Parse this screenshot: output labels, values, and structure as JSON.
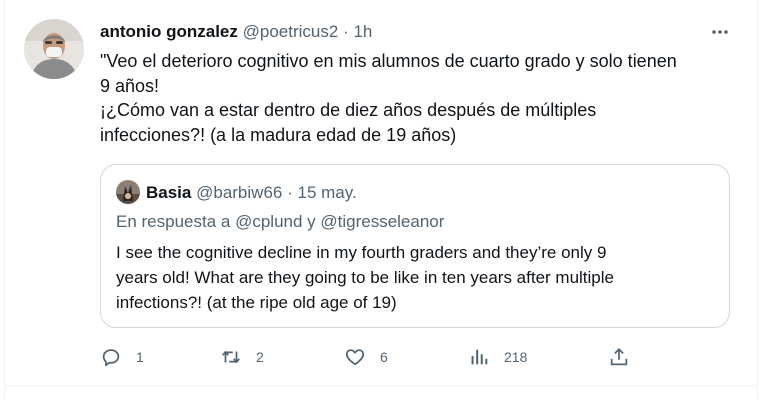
{
  "tweet": {
    "author_name": "antonio gonzalez",
    "handle": "@poetricus2",
    "separator": "·",
    "time": "1h",
    "text_lines": [
      "\"Veo el deterioro cognitivo en mis alumnos de cuarto grado y solo tienen",
      "9 años!",
      "¡¿Cómo van a estar dentro de diez años después de múltiples",
      "infecciones?! (a la madura edad de 19 años)"
    ]
  },
  "quote": {
    "author_name": "Basia",
    "handle": "@barbiw66",
    "separator": "·",
    "date": "15 may.",
    "reply_line": "En respuesta a @cplund y @tigresseleanor",
    "text_lines": [
      "I see the cognitive decline in my fourth graders and they’re only 9",
      "years old! What are they going to be like in ten years after multiple",
      "infections?! (at the ripe old age of 19)"
    ]
  },
  "actions": {
    "replies": "1",
    "retweets": "2",
    "likes": "6",
    "views": "218"
  },
  "colors": {
    "text": "#0f1419",
    "muted": "#536471",
    "border": "#cfd9de"
  },
  "icons": [
    "more-icon",
    "reply-icon",
    "retweet-icon",
    "like-icon",
    "views-icon",
    "share-icon"
  ]
}
